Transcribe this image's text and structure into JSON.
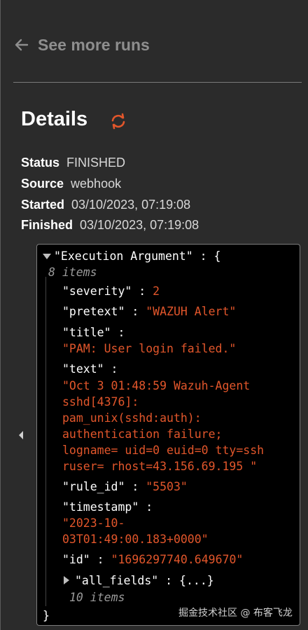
{
  "nav": {
    "back_label": "See more runs"
  },
  "details": {
    "title": "Details",
    "fields": [
      {
        "key": "Status",
        "value": "FINISHED"
      },
      {
        "key": "Source",
        "value": "webhook"
      },
      {
        "key": "Started",
        "value": "03/10/2023, 07:19:08"
      },
      {
        "key": "Finished",
        "value": "03/10/2023, 07:19:08"
      }
    ]
  },
  "json_view": {
    "root_key": "\"Execution Argument\"",
    "root_count": "8 items",
    "entries": {
      "severity": {
        "key": "\"severity\"",
        "value": "2"
      },
      "pretext": {
        "key": "\"pretext\"",
        "value": "\"WAZUH Alert\""
      },
      "title": {
        "key": "\"title\"",
        "value": "\"PAM: User login failed.\""
      },
      "text": {
        "key": "\"text\"",
        "value_lines": [
          "\"Oct 3 01:48:59 Wazuh-Agent",
          "sshd[4376]:",
          "pam_unix(sshd:auth):",
          "authentication failure;",
          "logname= uid=0 euid=0 tty=ssh",
          "ruser= rhost=43.156.69.195 \""
        ]
      },
      "rule_id": {
        "key": "\"rule_id\"",
        "value": "\"5503\""
      },
      "timestamp": {
        "key": "\"timestamp\"",
        "value_lines": [
          "\"2023-10-",
          "03T01:49:00.183+0000\""
        ]
      },
      "id": {
        "key": "\"id\"",
        "value": "\"1696297740.649670\""
      },
      "all_fields": {
        "key": "\"all_fields\"",
        "collapsed": "{...}",
        "count": "10 items"
      }
    }
  },
  "watermark": "掘金技术社区 @ 布客飞龙",
  "colors": {
    "string": "#e2562b",
    "accent_refresh": "#e2562b",
    "muted": "#8e8e8e"
  }
}
